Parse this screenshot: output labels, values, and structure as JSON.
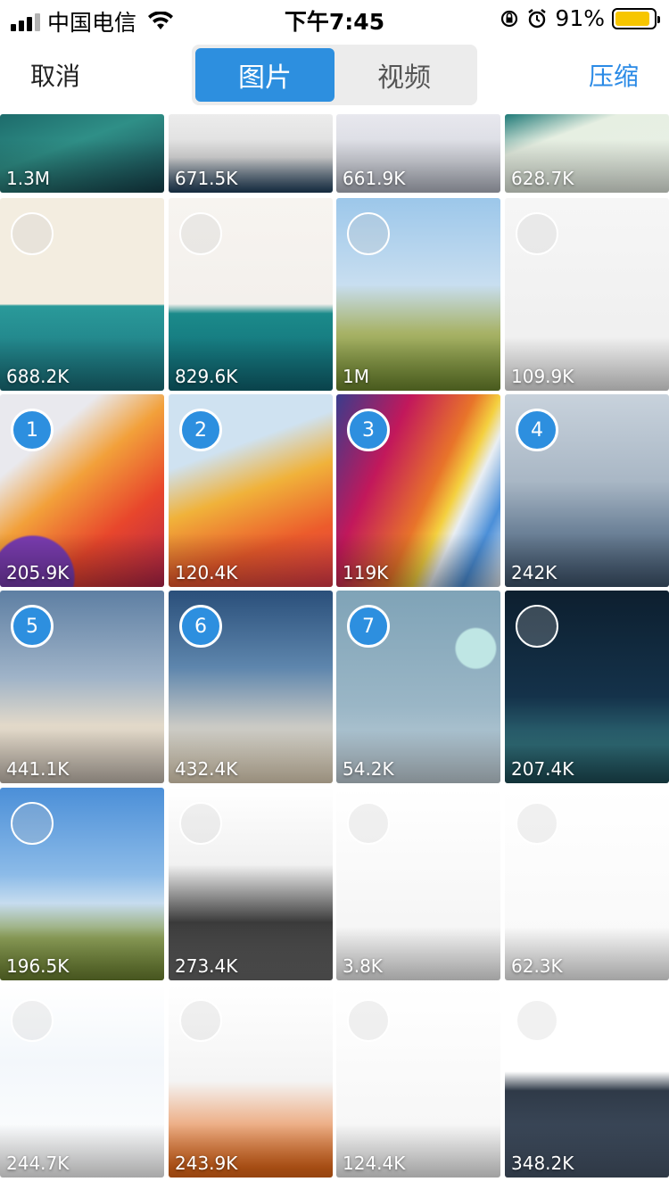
{
  "status": {
    "carrier": "中国电信",
    "time": "下午7:45",
    "battery": "91%",
    "battery_level": 0.91
  },
  "nav": {
    "cancel": "取消",
    "compress": "压缩",
    "tabs": [
      {
        "label": "图片",
        "active": true
      },
      {
        "label": "视频",
        "active": false
      }
    ]
  },
  "photos": [
    {
      "size": "1.3M",
      "selection": ""
    },
    {
      "size": "671.5K",
      "selection": ""
    },
    {
      "size": "661.9K",
      "selection": ""
    },
    {
      "size": "628.7K",
      "selection": ""
    },
    {
      "size": "688.2K",
      "selection": ""
    },
    {
      "size": "829.6K",
      "selection": ""
    },
    {
      "size": "1M",
      "selection": ""
    },
    {
      "size": "109.9K",
      "selection": ""
    },
    {
      "size": "205.9K",
      "selection": "1"
    },
    {
      "size": "120.4K",
      "selection": "2"
    },
    {
      "size": "119K",
      "selection": "3"
    },
    {
      "size": "242K",
      "selection": "4"
    },
    {
      "size": "441.1K",
      "selection": "5"
    },
    {
      "size": "432.4K",
      "selection": "6"
    },
    {
      "size": "54.2K",
      "selection": "7"
    },
    {
      "size": "207.4K",
      "selection": ""
    },
    {
      "size": "196.5K",
      "selection": ""
    },
    {
      "size": "273.4K",
      "selection": ""
    },
    {
      "size": "3.8K",
      "selection": ""
    },
    {
      "size": "62.3K",
      "selection": ""
    },
    {
      "size": "244.7K",
      "selection": ""
    },
    {
      "size": "243.9K",
      "selection": ""
    },
    {
      "size": "124.4K",
      "selection": ""
    },
    {
      "size": "348.2K",
      "selection": ""
    }
  ],
  "colors": {
    "accent": "#2d8fdf",
    "battery": "#f7c600"
  }
}
